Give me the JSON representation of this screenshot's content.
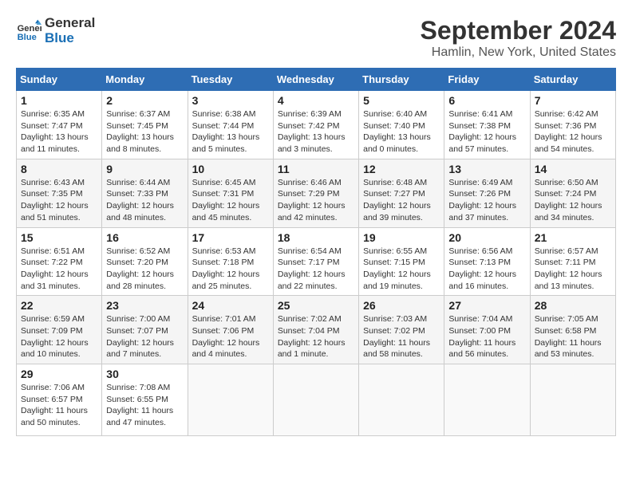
{
  "logo": {
    "line1": "General",
    "line2": "Blue"
  },
  "title": "September 2024",
  "location": "Hamlin, New York, United States",
  "weekdays": [
    "Sunday",
    "Monday",
    "Tuesday",
    "Wednesday",
    "Thursday",
    "Friday",
    "Saturday"
  ],
  "weeks": [
    [
      {
        "day": "1",
        "sunrise": "6:35 AM",
        "sunset": "7:47 PM",
        "daylight": "13 hours and 11 minutes."
      },
      {
        "day": "2",
        "sunrise": "6:37 AM",
        "sunset": "7:45 PM",
        "daylight": "13 hours and 8 minutes."
      },
      {
        "day": "3",
        "sunrise": "6:38 AM",
        "sunset": "7:44 PM",
        "daylight": "13 hours and 5 minutes."
      },
      {
        "day": "4",
        "sunrise": "6:39 AM",
        "sunset": "7:42 PM",
        "daylight": "13 hours and 3 minutes."
      },
      {
        "day": "5",
        "sunrise": "6:40 AM",
        "sunset": "7:40 PM",
        "daylight": "13 hours and 0 minutes."
      },
      {
        "day": "6",
        "sunrise": "6:41 AM",
        "sunset": "7:38 PM",
        "daylight": "12 hours and 57 minutes."
      },
      {
        "day": "7",
        "sunrise": "6:42 AM",
        "sunset": "7:36 PM",
        "daylight": "12 hours and 54 minutes."
      }
    ],
    [
      {
        "day": "8",
        "sunrise": "6:43 AM",
        "sunset": "7:35 PM",
        "daylight": "12 hours and 51 minutes."
      },
      {
        "day": "9",
        "sunrise": "6:44 AM",
        "sunset": "7:33 PM",
        "daylight": "12 hours and 48 minutes."
      },
      {
        "day": "10",
        "sunrise": "6:45 AM",
        "sunset": "7:31 PM",
        "daylight": "12 hours and 45 minutes."
      },
      {
        "day": "11",
        "sunrise": "6:46 AM",
        "sunset": "7:29 PM",
        "daylight": "12 hours and 42 minutes."
      },
      {
        "day": "12",
        "sunrise": "6:48 AM",
        "sunset": "7:27 PM",
        "daylight": "12 hours and 39 minutes."
      },
      {
        "day": "13",
        "sunrise": "6:49 AM",
        "sunset": "7:26 PM",
        "daylight": "12 hours and 37 minutes."
      },
      {
        "day": "14",
        "sunrise": "6:50 AM",
        "sunset": "7:24 PM",
        "daylight": "12 hours and 34 minutes."
      }
    ],
    [
      {
        "day": "15",
        "sunrise": "6:51 AM",
        "sunset": "7:22 PM",
        "daylight": "12 hours and 31 minutes."
      },
      {
        "day": "16",
        "sunrise": "6:52 AM",
        "sunset": "7:20 PM",
        "daylight": "12 hours and 28 minutes."
      },
      {
        "day": "17",
        "sunrise": "6:53 AM",
        "sunset": "7:18 PM",
        "daylight": "12 hours and 25 minutes."
      },
      {
        "day": "18",
        "sunrise": "6:54 AM",
        "sunset": "7:17 PM",
        "daylight": "12 hours and 22 minutes."
      },
      {
        "day": "19",
        "sunrise": "6:55 AM",
        "sunset": "7:15 PM",
        "daylight": "12 hours and 19 minutes."
      },
      {
        "day": "20",
        "sunrise": "6:56 AM",
        "sunset": "7:13 PM",
        "daylight": "12 hours and 16 minutes."
      },
      {
        "day": "21",
        "sunrise": "6:57 AM",
        "sunset": "7:11 PM",
        "daylight": "12 hours and 13 minutes."
      }
    ],
    [
      {
        "day": "22",
        "sunrise": "6:59 AM",
        "sunset": "7:09 PM",
        "daylight": "12 hours and 10 minutes."
      },
      {
        "day": "23",
        "sunrise": "7:00 AM",
        "sunset": "7:07 PM",
        "daylight": "12 hours and 7 minutes."
      },
      {
        "day": "24",
        "sunrise": "7:01 AM",
        "sunset": "7:06 PM",
        "daylight": "12 hours and 4 minutes."
      },
      {
        "day": "25",
        "sunrise": "7:02 AM",
        "sunset": "7:04 PM",
        "daylight": "12 hours and 1 minute."
      },
      {
        "day": "26",
        "sunrise": "7:03 AM",
        "sunset": "7:02 PM",
        "daylight": "11 hours and 58 minutes."
      },
      {
        "day": "27",
        "sunrise": "7:04 AM",
        "sunset": "7:00 PM",
        "daylight": "11 hours and 56 minutes."
      },
      {
        "day": "28",
        "sunrise": "7:05 AM",
        "sunset": "6:58 PM",
        "daylight": "11 hours and 53 minutes."
      }
    ],
    [
      {
        "day": "29",
        "sunrise": "7:06 AM",
        "sunset": "6:57 PM",
        "daylight": "11 hours and 50 minutes."
      },
      {
        "day": "30",
        "sunrise": "7:08 AM",
        "sunset": "6:55 PM",
        "daylight": "11 hours and 47 minutes."
      },
      null,
      null,
      null,
      null,
      null
    ]
  ],
  "labels": {
    "sunrise": "Sunrise:",
    "sunset": "Sunset:",
    "daylight": "Daylight:"
  }
}
